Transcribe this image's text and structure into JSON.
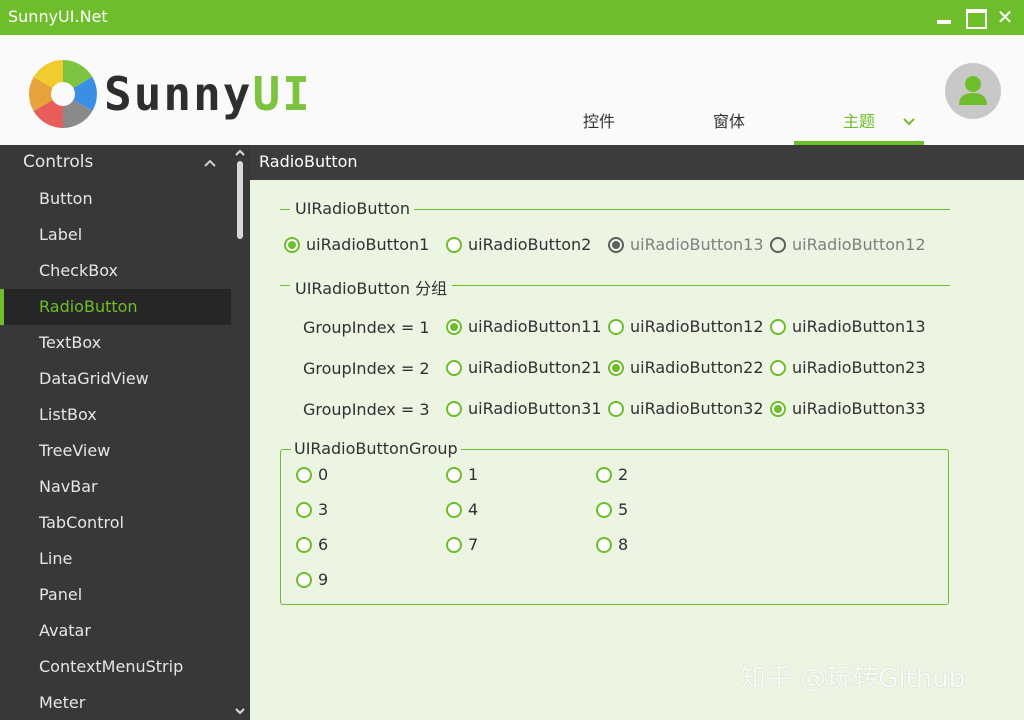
{
  "window": {
    "title": "SunnyUI.Net",
    "accent_color": "#6ebd2a",
    "buttons": {
      "minimize": "minimize-icon",
      "maximize": "maximize-icon",
      "close": "close-icon"
    }
  },
  "header": {
    "logo": {
      "text_dark": "Sunny",
      "text_accent": "UI"
    },
    "tabs": [
      {
        "label": "控件",
        "active": false
      },
      {
        "label": "窗体",
        "active": false
      },
      {
        "label": "主题",
        "active": true
      }
    ],
    "avatar_icon": "user-icon"
  },
  "sidebar": {
    "group_label": "Controls",
    "items": [
      {
        "label": "Button"
      },
      {
        "label": "Label"
      },
      {
        "label": "CheckBox"
      },
      {
        "label": "RadioButton",
        "active": true
      },
      {
        "label": "TextBox"
      },
      {
        "label": "DataGridView"
      },
      {
        "label": "ListBox"
      },
      {
        "label": "TreeView"
      },
      {
        "label": "NavBar"
      },
      {
        "label": "TabControl"
      },
      {
        "label": "Line"
      },
      {
        "label": "Panel"
      },
      {
        "label": "Avatar"
      },
      {
        "label": "ContextMenuStrip"
      },
      {
        "label": "Meter"
      }
    ]
  },
  "page": {
    "title": "RadioButton",
    "section1": {
      "title": "UIRadioButton",
      "radios": [
        {
          "label": "uiRadioButton1",
          "checked": true,
          "style": "green"
        },
        {
          "label": "uiRadioButton2",
          "checked": false,
          "style": "green"
        },
        {
          "label": "uiRadioButton13",
          "checked": true,
          "style": "gray"
        },
        {
          "label": "uiRadioButton12",
          "checked": false,
          "style": "gray"
        }
      ]
    },
    "section2": {
      "title": "UIRadioButton 分组",
      "rows": [
        {
          "label": "GroupIndex = 1",
          "radios": [
            {
              "label": "uiRadioButton11",
              "checked": true
            },
            {
              "label": "uiRadioButton12",
              "checked": false
            },
            {
              "label": "uiRadioButton13",
              "checked": false
            }
          ]
        },
        {
          "label": "GroupIndex = 2",
          "radios": [
            {
              "label": "uiRadioButton21",
              "checked": false
            },
            {
              "label": "uiRadioButton22",
              "checked": true
            },
            {
              "label": "uiRadioButton23",
              "checked": false
            }
          ]
        },
        {
          "label": "GroupIndex = 3",
          "radios": [
            {
              "label": "uiRadioButton31",
              "checked": false
            },
            {
              "label": "uiRadioButton32",
              "checked": false
            },
            {
              "label": "uiRadioButton33",
              "checked": true
            }
          ]
        }
      ]
    },
    "group_box": {
      "title": "UIRadioButtonGroup",
      "items": [
        "0",
        "1",
        "2",
        "3",
        "4",
        "5",
        "6",
        "7",
        "8",
        "9"
      ]
    }
  },
  "watermark": "知乎 @玩转Github"
}
